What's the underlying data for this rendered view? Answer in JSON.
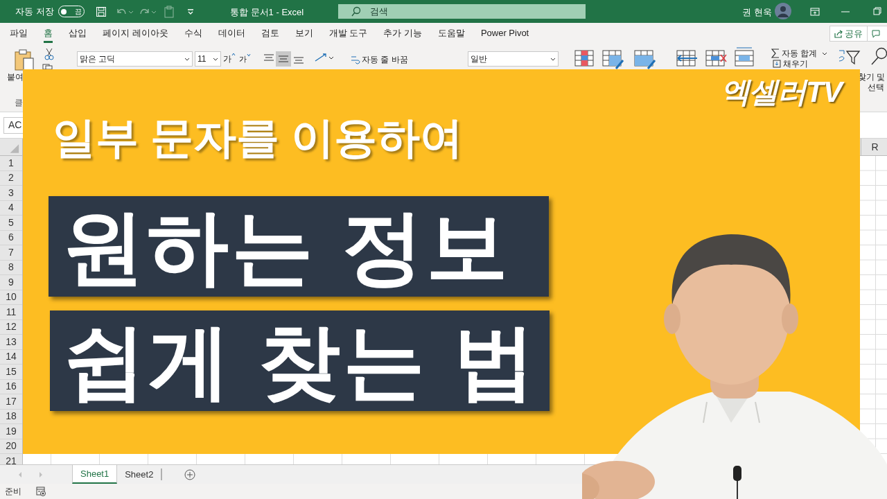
{
  "title_bar": {
    "autosave_label": "자동 저장",
    "autosave_toggle": {
      "on": false,
      "label": "끔"
    },
    "document_title": "통합 문서1  -  Excel",
    "search": {
      "placeholder": "검색"
    },
    "user_name": "권 현욱"
  },
  "ribbon_tabs": [
    {
      "label": "파일",
      "selected": false
    },
    {
      "label": "홈",
      "selected": true
    },
    {
      "label": "삽입",
      "selected": false
    },
    {
      "label": "페이지 레이아웃",
      "selected": false
    },
    {
      "label": "수식",
      "selected": false
    },
    {
      "label": "데이터",
      "selected": false
    },
    {
      "label": "검토",
      "selected": false
    },
    {
      "label": "보기",
      "selected": false
    },
    {
      "label": "개발 도구",
      "selected": false
    },
    {
      "label": "추가 기능",
      "selected": false
    },
    {
      "label": "도움말",
      "selected": false
    },
    {
      "label": "Power Pivot",
      "selected": false
    }
  ],
  "share_button": "공유",
  "ribbon": {
    "paste_label": "붙여",
    "clipboard_label": "클",
    "font_name": "맑은 고딕",
    "font_size": "11",
    "grow_font": "가",
    "shrink_font": "가",
    "wrap_text": "자동 줄 바꿈",
    "number_format": "일반",
    "autosum": "자동 합계",
    "fill": "채우기",
    "find_select_1": "찾기 및",
    "find_select_2": "선택"
  },
  "name_box": "AC",
  "column_headers": [
    "R"
  ],
  "row_headers": [
    "1",
    "2",
    "3",
    "4",
    "5",
    "6",
    "7",
    "8",
    "9",
    "10",
    "11",
    "12",
    "13",
    "14",
    "15",
    "16",
    "17",
    "18",
    "19",
    "20",
    "21"
  ],
  "sheet_tabs": [
    {
      "label": "Sheet1",
      "selected": true
    },
    {
      "label": "Sheet2",
      "selected": false
    }
  ],
  "status_bar": {
    "text": "준비"
  },
  "thumbnail": {
    "logo": "엑셀러TV",
    "subtitle": "일부 문자를 이용하여",
    "headline_lines": [
      "원하는 정보",
      "쉽게 찾는 법"
    ]
  }
}
